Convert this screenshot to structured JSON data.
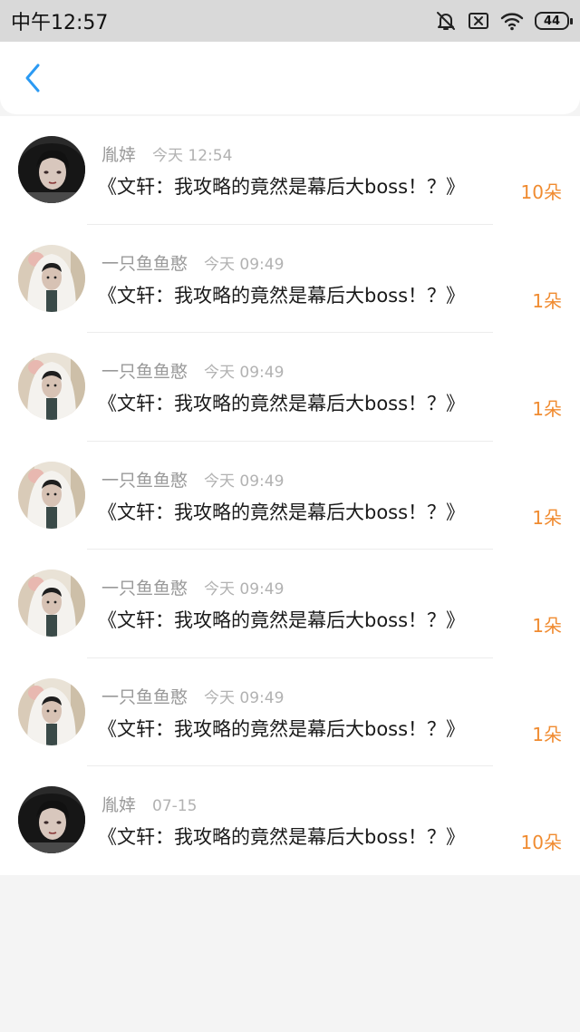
{
  "status_bar": {
    "time": "中午12:57",
    "battery": "44",
    "icons": [
      "bell-muted-icon",
      "sim-off-icon",
      "wifi-icon",
      "battery-icon"
    ]
  },
  "nav": {
    "back_icon": "chevron-left-icon",
    "accent": "#2b9af3"
  },
  "colors": {
    "amount": "#f08b30",
    "name": "#9a9a9a",
    "time": "#b2b2b2"
  },
  "records": [
    {
      "name": "胤婞",
      "time": "今天 12:54",
      "title": "《文轩：我攻略的竟然是幕后大boss！？》",
      "amount": "10朵",
      "avatar": "dark-hair"
    },
    {
      "name": "一只鱼鱼憨",
      "time": "今天 09:49",
      "title": "《文轩：我攻略的竟然是幕后大boss！？》",
      "amount": "1朵",
      "avatar": "white-hood"
    },
    {
      "name": "一只鱼鱼憨",
      "time": "今天 09:49",
      "title": "《文轩：我攻略的竟然是幕后大boss！？》",
      "amount": "1朵",
      "avatar": "white-hood"
    },
    {
      "name": "一只鱼鱼憨",
      "time": "今天 09:49",
      "title": "《文轩：我攻略的竟然是幕后大boss！？》",
      "amount": "1朵",
      "avatar": "white-hood"
    },
    {
      "name": "一只鱼鱼憨",
      "time": "今天 09:49",
      "title": "《文轩：我攻略的竟然是幕后大boss！？》",
      "amount": "1朵",
      "avatar": "white-hood"
    },
    {
      "name": "一只鱼鱼憨",
      "time": "今天 09:49",
      "title": "《文轩：我攻略的竟然是幕后大boss！？》",
      "amount": "1朵",
      "avatar": "white-hood"
    },
    {
      "name": "胤婞",
      "time": "07-15",
      "title": "《文轩：我攻略的竟然是幕后大boss！？》",
      "amount": "10朵",
      "avatar": "dark-hair"
    }
  ]
}
